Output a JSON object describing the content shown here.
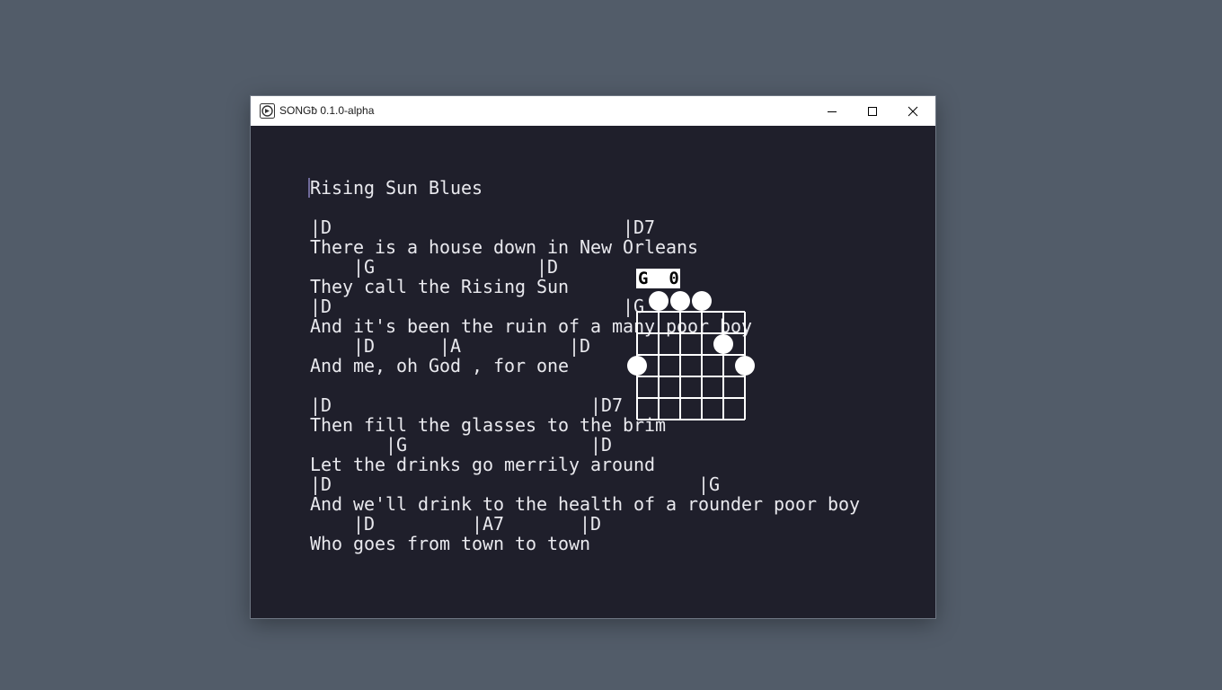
{
  "window": {
    "title": "SONGƀ 0.1.0-alpha",
    "controls": [
      "minimize-icon",
      "maximize-icon",
      "close-icon"
    ]
  },
  "song": {
    "title": "Rising Sun Blues",
    "lines": [
      "|D                           |D7",
      "There is a house down in New Orleans",
      "    |G               |D",
      "They call the Rising Sun",
      "|D                           |G",
      "And it's been the ruin of a many poor boy",
      "    |D      |A          |D",
      "And me, oh God , for one",
      "",
      "|D                        |D7",
      "Then fill the glasses to the brim",
      "       |G                 |D",
      "Let the drinks go merrily around",
      "|D                                  |G",
      "And we'll drink to the health of a rounder poor boy",
      "    |D         |A7       |D",
      "Who goes from town to town"
    ]
  },
  "chord_popup": {
    "label": "G  0",
    "open_strings": [
      1,
      2,
      3
    ],
    "fingers": [
      {
        "string": 4,
        "fret": 2
      },
      {
        "string": 0,
        "fret": 3
      },
      {
        "string": 5,
        "fret": 3
      }
    ]
  }
}
